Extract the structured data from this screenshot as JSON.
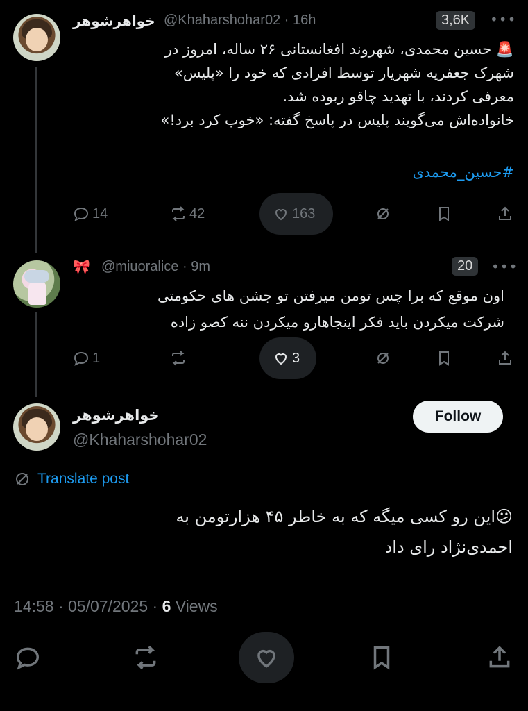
{
  "tweet1": {
    "display_name": "خواهرشوهر",
    "handle_time": "@Khaharshohar02 · 16h",
    "badge": "3,6K",
    "line1": "🚨 حسین محمدی، شهروند افغانستانی ۲۶ ساله، امروز در",
    "line2": "شهرک جعفریه شهریار توسط افرادی که خود را «پلیس»",
    "line3": "معرفی کردند، با تهدید چاقو ربوده شد.",
    "line4": "خانواده‌اش می‌گویند پلیس در پاسخ گفته: «خوب کرد برد!»",
    "hashtag": "#حسین_محمدی",
    "replies": "14",
    "reposts": "42",
    "likes": "163"
  },
  "reply": {
    "emoji": "🎀",
    "handle_time": "@miuoralice · 9m",
    "badge": "20",
    "line1": "اون موقع که برا چس تومن میرفتن تو جشن های حکومتی",
    "line2": "شرکت میکردن باید فکر اینجاهارو میکردن ننه کصو زاده",
    "replies": "1",
    "likes": "3"
  },
  "main": {
    "display_name": "خواهرشوهر",
    "handle": "@Khaharshohar02",
    "follow_label": "Follow",
    "translate_label": "Translate post",
    "line1": "😕این رو کسی میگه که به خاطر ۴۵ هزارتومن به",
    "line2": "احمدی‌نژاد رای داد",
    "timestamp": "14:58 · 05/07/2025 · ",
    "views_count": "6",
    "views_label": " Views"
  },
  "icons": {
    "reply": "reply-icon",
    "repost": "repost-icon",
    "like": "heart-icon",
    "grok": "grok-icon",
    "bookmark": "bookmark-icon",
    "share": "share-icon"
  },
  "colors": {
    "background": "#000000",
    "accent": "#1d9bf0",
    "muted": "#71767b"
  }
}
